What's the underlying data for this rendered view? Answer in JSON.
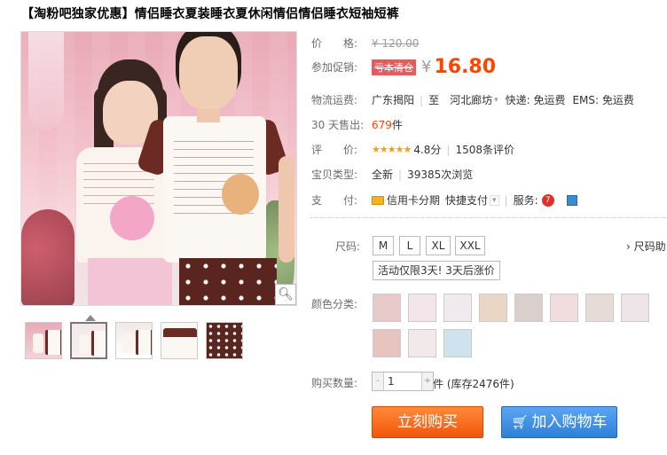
{
  "title": "【淘粉吧独家优惠】情侣睡衣夏装睡衣夏休闲情侣情侣睡衣短袖短裤",
  "price": {
    "label": "价　　格:",
    "value": "¥ 120.00"
  },
  "promo": {
    "label": "参加促销:",
    "badge": "亏本清仓",
    "currency": "¥",
    "value": "16.80"
  },
  "shipping": {
    "label": "物流运费:",
    "from": "广东揭阳",
    "to": "至　河北廊坊",
    "express": "快递: 免运费",
    "ems": "EMS: 免运费"
  },
  "sales": {
    "label": "30 天售出:",
    "count": "679",
    "unit": "件"
  },
  "rating": {
    "label": "评　　价:",
    "stars": "★★★★★",
    "score": "4.8分",
    "reviews": "1508条评价"
  },
  "type": {
    "label": "宝贝类型:",
    "value": "全新",
    "views": "39385次浏览"
  },
  "payment": {
    "label": "支　　付:",
    "credit": "信用卡分期",
    "quick": "快捷支付",
    "service_label": "服务:",
    "service_badge": "7"
  },
  "sku": {
    "size_label": "尺码:",
    "sizes": [
      "M",
      "L",
      "XL",
      "XXL"
    ],
    "size_guide": "› 尺码助",
    "activity": "活动仅限3天! 3天后涨价",
    "color_label": "颜色分类:"
  },
  "quantity": {
    "label": "购买数量:",
    "value": "1",
    "minus": "-",
    "plus": "+",
    "stock": "件 (库存2476件)"
  },
  "buttons": {
    "buy": "立刻购买",
    "cart": "加入购物车"
  },
  "icons": {
    "zoom": "magnifier-icon",
    "cart": "cart-icon",
    "card": "credit-card-icon"
  },
  "colors": {
    "accent": "#ff4400",
    "buy_button": "#f2560a",
    "cart_button": "#2f7fd6",
    "promo_badge": "#e85b5b"
  }
}
